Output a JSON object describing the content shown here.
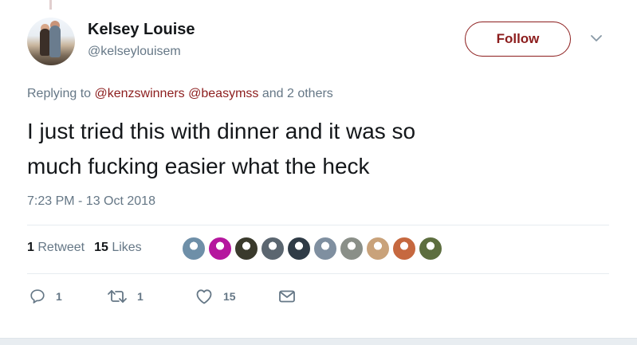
{
  "author": {
    "display_name": "Kelsey Louise",
    "handle": "@kelseylouisem"
  },
  "follow_label": "Follow",
  "reply": {
    "prefix": "Replying to",
    "mentions": [
      "@kenzswinners",
      "@beasymss"
    ],
    "suffix": "and 2 others"
  },
  "tweet": {
    "lines": [
      "I just tried this with dinner and it was so",
      "much fucking easier what the heck"
    ],
    "timestamp": "7:23 PM - 13 Oct 2018"
  },
  "stats": {
    "retweets_count": "1",
    "retweets_label": "Retweet",
    "likes_count": "15",
    "likes_label": "Likes"
  },
  "liker_colors": [
    "#6e8fa8",
    "#b5179e",
    "#3a3a2c",
    "#5b6670",
    "#2f3b46",
    "#7f8fa0",
    "#8a8f88",
    "#c9a27a",
    "#c6683f",
    "#5d6e3f"
  ],
  "actions": {
    "reply_count": "1",
    "retweet_count": "1",
    "like_count": "15"
  },
  "colors": {
    "accent": "#8c1d1d",
    "muted": "#657786",
    "text": "#14171a"
  }
}
